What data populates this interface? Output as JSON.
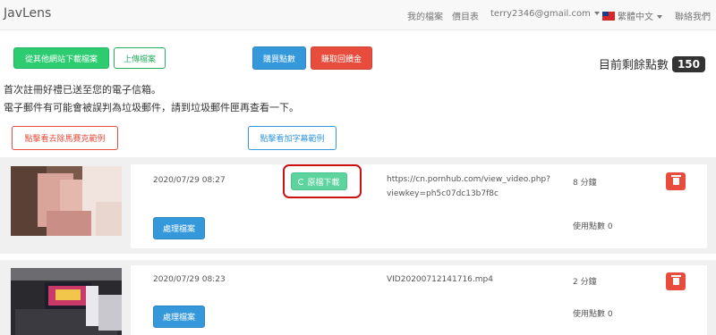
{
  "navbar": {
    "brand": "JavLens",
    "my_files": "我的檔案",
    "pricing": "價目表",
    "account": "terry2346@gmail.com",
    "language": "繁體中文",
    "contact": "聯絡我們"
  },
  "actions": {
    "download_other_site": "從其他網站下載檔案",
    "upload_file": "上傳檔案",
    "buy_points": "購買點數",
    "earn_rebate": "賺取回饋金"
  },
  "points": {
    "label": "目前剩餘點數",
    "value": "150"
  },
  "notice": {
    "line1": "首次註冊好禮已送至您的電子信箱。",
    "line2": "電子郵件有可能會被誤判為垃圾郵件，請到垃圾郵件匣再查看一下。"
  },
  "examples": {
    "mosaic_removal": "點擊看去除馬賽克範例",
    "subtitle": "點擊看加字幕範例"
  },
  "files": [
    {
      "date": "2020/07/29 08:27",
      "status_button": "原檔下載",
      "source": "https://cn.pornhub.com/view_video.php?viewkey=ph5c07dc13b7f8c",
      "duration": "8 分鐘",
      "points_used": "使用點數 0",
      "process_button": "處理檔案"
    },
    {
      "date": "2020/07/29 08:23",
      "source": "VID20200712141716.mp4",
      "duration": "2 分鐘",
      "points_used": "使用點數 0",
      "process_button": "處理檔案"
    }
  ],
  "colors": {
    "green": "#2ecc71",
    "blue": "#3498db",
    "red": "#e74c3c",
    "highlight": "#cc1111"
  }
}
